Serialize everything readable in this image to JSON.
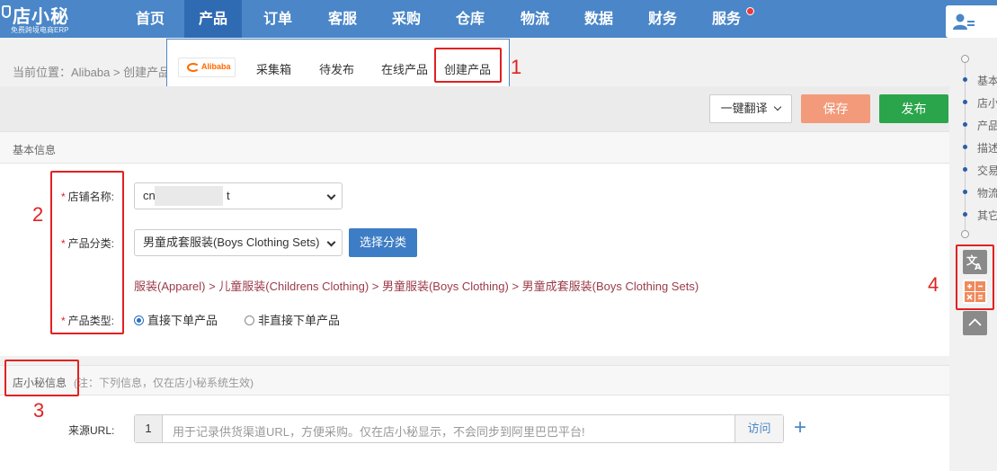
{
  "brand": {
    "name": "店小秘",
    "tagline": "免费跨境电商ERP"
  },
  "nav": {
    "items": [
      {
        "label": "首页"
      },
      {
        "label": "产品"
      },
      {
        "label": "订单"
      },
      {
        "label": "客服"
      },
      {
        "label": "采购"
      },
      {
        "label": "仓库"
      },
      {
        "label": "物流"
      },
      {
        "label": "数据"
      },
      {
        "label": "财务"
      },
      {
        "label": "服务"
      }
    ],
    "active": "产品"
  },
  "breadcrumb": {
    "text": "当前位置：Alibaba > 创建产品"
  },
  "dropdown": {
    "platform": "Alibaba",
    "items": [
      {
        "label": "采集箱"
      },
      {
        "label": "待发布"
      },
      {
        "label": "在线产品"
      },
      {
        "label": "创建产品"
      }
    ]
  },
  "toolbar": {
    "translate_label": "一键翻译",
    "save_label": "保存",
    "publish_label": "发布"
  },
  "basic": {
    "title": "基本信息",
    "store_label": "店铺名称:",
    "store_value_prefix": "cn",
    "store_value_suffix": "t",
    "category_label": "产品分类:",
    "category_value": "男童成套服装(Boys Clothing Sets)",
    "choose_category": "选择分类",
    "category_path": "服装(Apparel)  > 儿童服装(Childrens Clothing)  > 男童服装(Boys Clothing)  > 男童成套服装(Boys Clothing Sets)",
    "type_label": "产品类型:",
    "type_options": [
      {
        "label": "直接下单产品",
        "selected": true
      },
      {
        "label": "非直接下单产品",
        "selected": false
      }
    ]
  },
  "dxm": {
    "title": "店小秘信息",
    "note": "(注：下列信息，仅在店小秘系统生效)",
    "url_label": "来源URL:",
    "url_index": "1",
    "url_placeholder": "用于记录供货渠道URL，方便采购。仅在店小秘显示，不会同步到阿里巴巴平台!",
    "visit_label": "访问",
    "add_icon": "plus-icon"
  },
  "rail": {
    "items": [
      "基本",
      "店小",
      "产品",
      "描述",
      "交易",
      "物流",
      "其它"
    ]
  },
  "annotations": [
    "1",
    "2",
    "3",
    "4"
  ],
  "colors": {
    "nav": "#4a86c8",
    "save": "#f39a7b",
    "publish": "#2aa54b",
    "highlight": "#e32020"
  }
}
